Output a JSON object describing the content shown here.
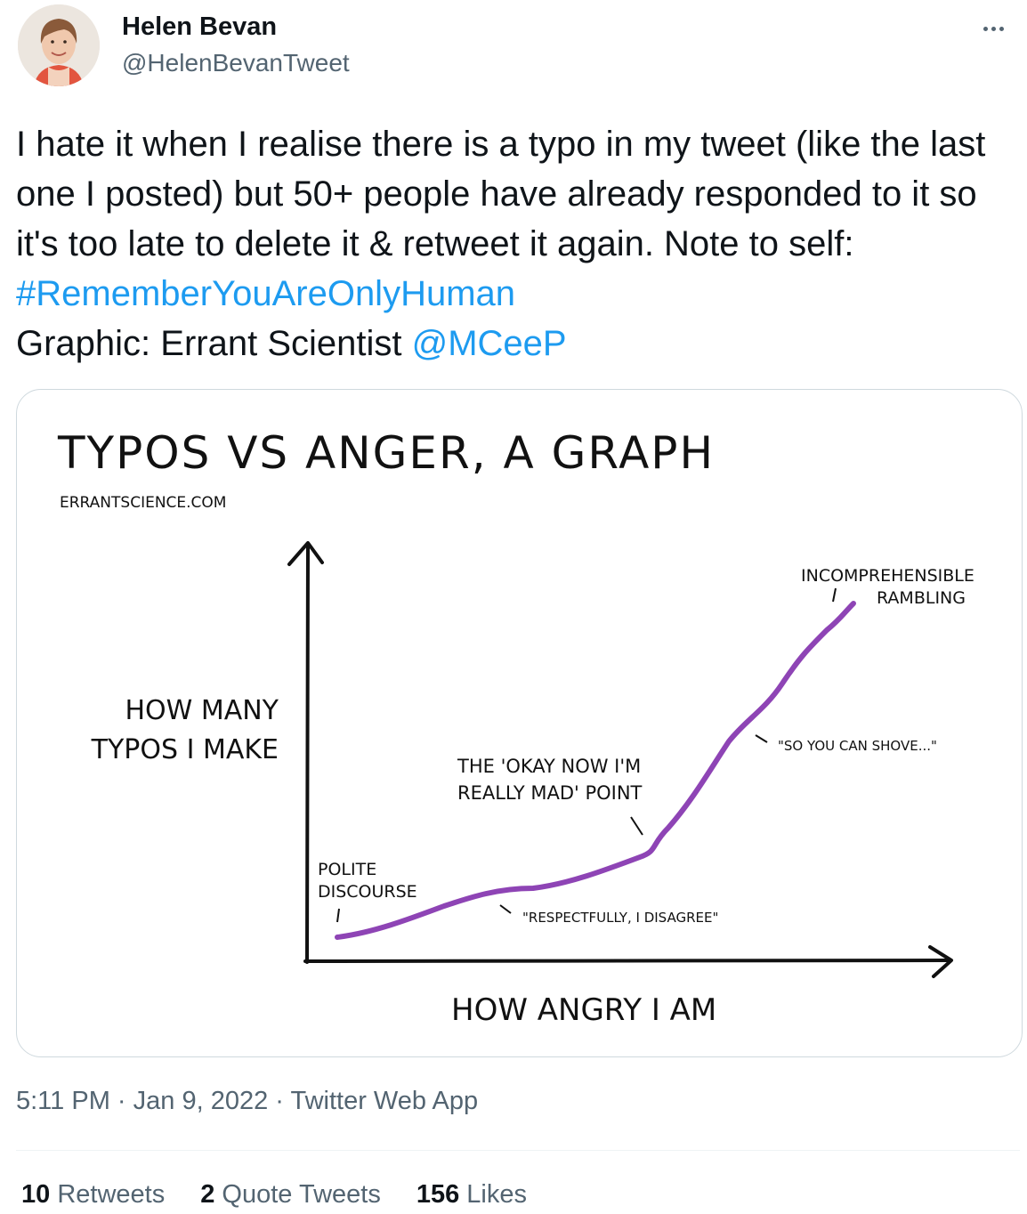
{
  "author": {
    "name": "Helen Bevan",
    "handle": "@HelenBevanTweet"
  },
  "tweet": {
    "text_1": "I hate it when I realise there is a typo in my tweet (like the last one I posted) but 50+ people have already responded to it so it's too late to delete it & retweet it again. Note to self: ",
    "hashtag": "#RememberYouAreOnlyHuman",
    "text_2": "Graphic: Errant Scientist ",
    "mention": "@MCeeP"
  },
  "graphic": {
    "title": "TYPOS VS ANGER, A GRAPH",
    "source": "ERRANTSCIENCE.COM",
    "y_label_line1": "HOW MANY",
    "y_label_line2": "TYPOS I MAKE",
    "x_label": "HOW ANGRY I AM",
    "annotations": {
      "polite_1": "POLITE",
      "polite_2": "DISCOURSE",
      "respectfully": "\"RESPECTFULLY, I DISAGREE\"",
      "okay_1": "THE 'OKAY NOW I'M",
      "okay_2": "REALLY MAD' POINT",
      "shove": "\"SO YOU CAN SHOVE...\"",
      "incomp_1": "INCOMPREHENSIBLE",
      "incomp_2": "RAMBLING"
    },
    "line_color": "#8e44b5"
  },
  "chart_data": {
    "type": "line",
    "title": "TYPOS VS ANGER, A GRAPH",
    "xlabel": "HOW ANGRY I AM",
    "ylabel": "HOW MANY TYPOS I MAKE",
    "ticks": "none",
    "annotations": [
      "POLITE DISCOURSE",
      "\"RESPECTFULLY, I DISAGREE\"",
      "THE 'OKAY NOW I'M REALLY MAD' POINT",
      "\"SO YOU CAN SHOVE...\"",
      "INCOMPREHENSIBLE RAMBLING"
    ]
  },
  "meta": {
    "time": "5:11 PM",
    "sep": " · ",
    "date": "Jan 9, 2022",
    "app": "Twitter Web App"
  },
  "stats": {
    "retweets_count": "10",
    "retweets_label": "Retweets",
    "quotes_count": "2",
    "quotes_label": "Quote Tweets",
    "likes_count": "156",
    "likes_label": "Likes"
  }
}
